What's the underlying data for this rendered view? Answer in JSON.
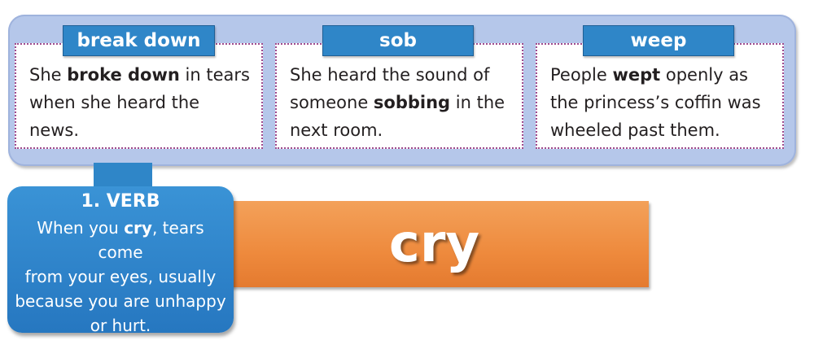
{
  "synonyms": [
    {
      "word": "break down",
      "example": [
        {
          "t": "She ",
          "b": false
        },
        {
          "t": "broke down",
          "b": true
        },
        {
          "t": " in tears",
          "b": false
        },
        {
          "t": "\nwhen she heard the news.",
          "b": false
        }
      ]
    },
    {
      "word": "sob",
      "example": [
        {
          "t": "She heard the sound of\nsomeone ",
          "b": false
        },
        {
          "t": "sobbing",
          "b": true
        },
        {
          "t": " in the\nnext room.",
          "b": false
        }
      ]
    },
    {
      "word": "weep",
      "example": [
        {
          "t": "People ",
          "b": false
        },
        {
          "t": "wept",
          "b": true
        },
        {
          "t": " openly as\nthe princess’s coffin was\nwheeled past them.",
          "b": false
        }
      ]
    }
  ],
  "definition": {
    "heading": "1. VERB",
    "text": [
      {
        "t": "When you ",
        "b": false
      },
      {
        "t": "cry",
        "b": true
      },
      {
        "t": ", tears come\nfrom your eyes, usually\nbecause you are unhappy\nor hurt.",
        "b": false
      }
    ]
  },
  "headword": "cry",
  "colors": {
    "panel": "#b5c7ea",
    "tab_blue": "#2f86c8",
    "orange": "#ee8a3d",
    "dotted_border": "#a04a8c"
  }
}
